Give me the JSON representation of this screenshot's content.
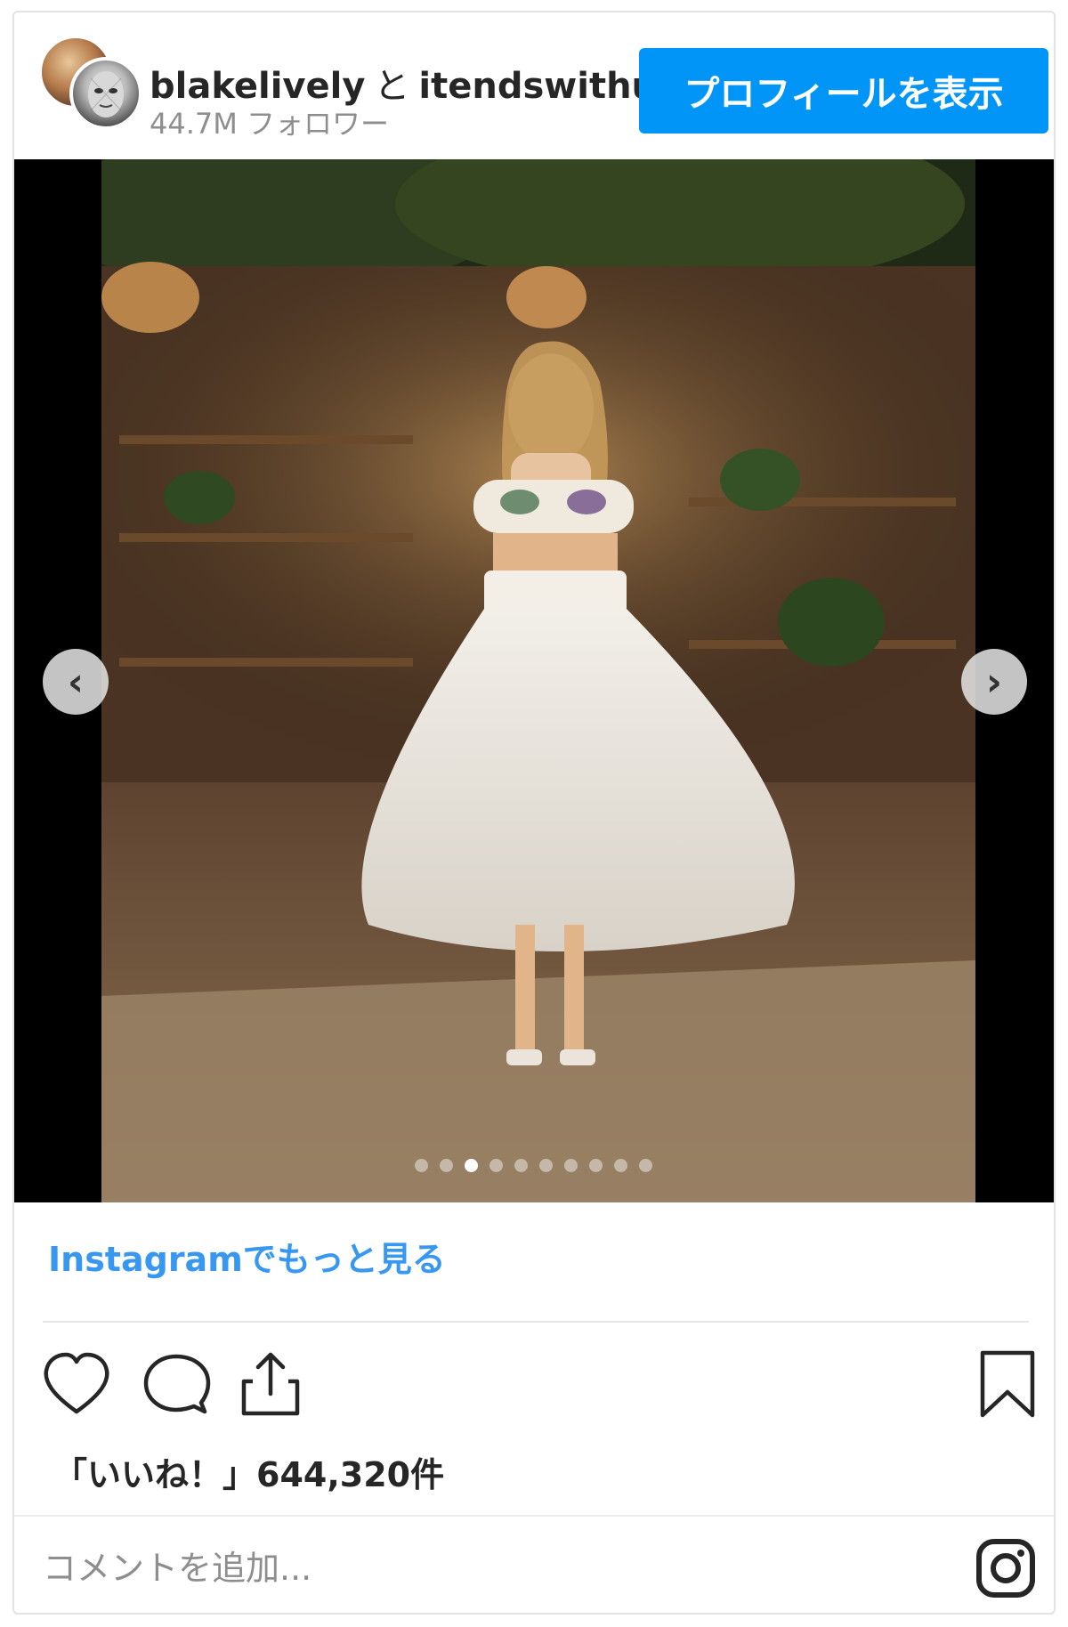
{
  "post": {
    "user_primary": "blakelively",
    "and_word": "と",
    "user_secondary": "itendswithus.",
    "followers": "44.7M フォロワー",
    "profile_button": "プロフィールを表示"
  },
  "carousel": {
    "prev_icon": "chevron-left-icon",
    "next_icon": "chevron-right-icon",
    "prev_glyph": "‹",
    "next_glyph": "›",
    "page_count": 10,
    "active_index": 2
  },
  "more_link": "Instagramでもっと見る",
  "likes": "「いいね！」644,320件",
  "comment": {
    "placeholder": "コメントを追加..."
  },
  "colors": {
    "accent": "#0095f6",
    "link": "#3897f0",
    "muted": "#8e8e8e"
  }
}
